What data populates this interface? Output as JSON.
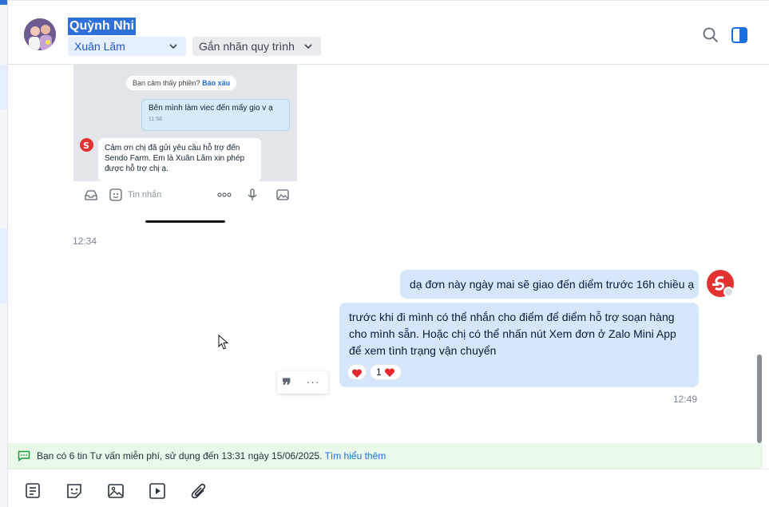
{
  "header": {
    "contact_name": "Quỳnh Nhi",
    "assignee": "Xuân Lãm",
    "workflow_tag": "Gắn nhãn quy trình",
    "accent_color": "#2f6fd8"
  },
  "shared_image": {
    "pill_text": "Bạn cảm thấy phiền?",
    "pill_link": "Báo xấu",
    "outgoing_text": "Bên mình làm viec đến mấy gio v ạ",
    "outgoing_time": "11:58",
    "incoming_text": "Cảm ơn chị đã gửi yêu cầu hỗ trợ đến Sendo Farm. Em là Xuân Lãm xin phép được hỗ trợ chị ạ.",
    "input_placeholder": "Tin nhắn",
    "time": "12:34"
  },
  "messages": [
    {
      "text": "dạ đơn này ngày mai sẽ giao đến diểm trước 16h chiều ạ"
    },
    {
      "text": "trước khi đi mình có thể nhắn cho điểm để diểm hỗ trợ soạn hàng cho mình sẵn. Hoặc chị có thể nhấn nút Xem đơn ở Zalo Mini App để xem tình trạng vận chuyển",
      "reaction_count": "1"
    }
  ],
  "last_time": "12:49",
  "notice": {
    "text": "Bạn có 6 tin Tư vấn miễn phí, sử dụng đến 13:31 ngày 15/06/2025.",
    "link": "Tìm hiểu thêm"
  },
  "icons": {
    "header": [
      "search-icon",
      "sidebar-toggle-icon"
    ],
    "toolbar": [
      "text-format-icon",
      "sticker-icon",
      "image-icon",
      "video-icon",
      "attachment-icon"
    ],
    "hover": [
      "quote-icon",
      "more-icon"
    ]
  }
}
